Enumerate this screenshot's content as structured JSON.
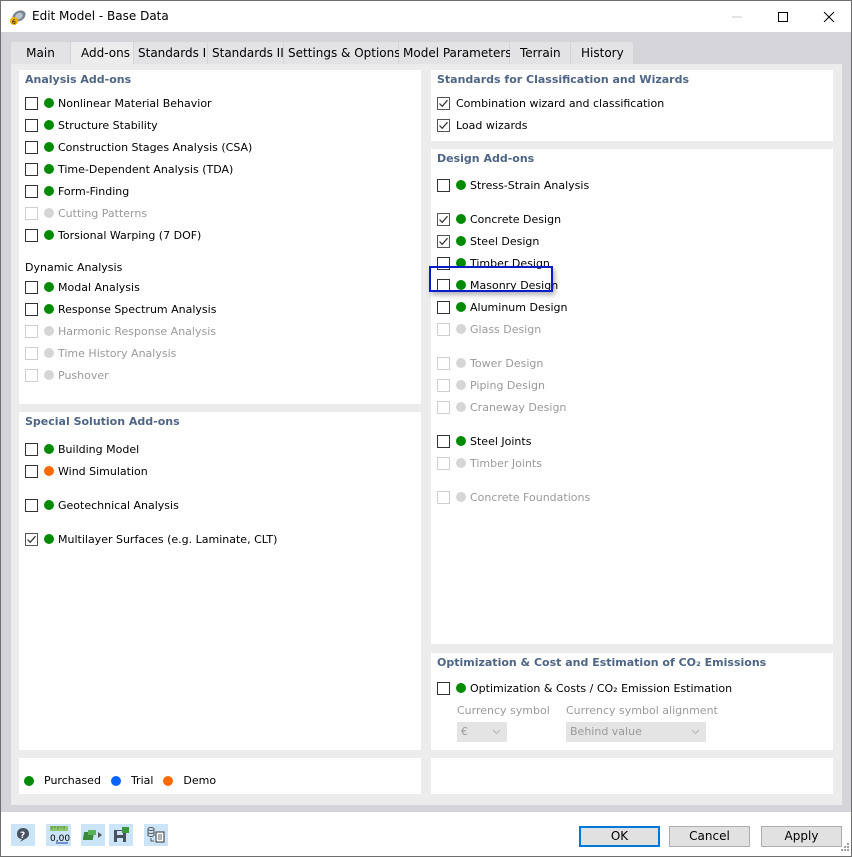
{
  "window": {
    "title": "Edit Model - Base Data",
    "icon": "model-icon",
    "controls": [
      "minimize",
      "maximize",
      "close"
    ]
  },
  "tabs": [
    {
      "label": "Main",
      "active": false
    },
    {
      "label": "Add-ons",
      "active": true
    },
    {
      "label": "Standards I",
      "active": false
    },
    {
      "label": "Standards II",
      "active": false
    },
    {
      "label": "Settings & Options",
      "active": false
    },
    {
      "label": "Model Parameters",
      "active": false
    },
    {
      "label": "Terrain",
      "active": false
    },
    {
      "label": "History",
      "active": false
    }
  ],
  "colors": {
    "purchased": "#008a00",
    "trial": "#0a64ff",
    "demo": "#ff6a00",
    "disabled": "#d6d6d6",
    "section_title": "#4e6585",
    "highlight": "#0a1ec8"
  },
  "analysis_addons": {
    "title": "Analysis Add-ons",
    "items": [
      {
        "label": "Nonlinear Material Behavior",
        "checked": false,
        "status": "purchased",
        "enabled": true
      },
      {
        "label": "Structure Stability",
        "checked": false,
        "status": "purchased",
        "enabled": true
      },
      {
        "label": "Construction Stages Analysis (CSA)",
        "checked": false,
        "status": "purchased",
        "enabled": true
      },
      {
        "label": "Time-Dependent Analysis (TDA)",
        "checked": false,
        "status": "purchased",
        "enabled": true
      },
      {
        "label": "Form-Finding",
        "checked": false,
        "status": "purchased",
        "enabled": true
      },
      {
        "label": "Cutting Patterns",
        "checked": false,
        "status": "unavailable",
        "enabled": false
      },
      {
        "label": "Torsional Warping (7 DOF)",
        "checked": false,
        "status": "purchased",
        "enabled": true
      }
    ],
    "dynamic_heading": "Dynamic Analysis",
    "dynamic_items": [
      {
        "label": "Modal Analysis",
        "checked": false,
        "status": "purchased",
        "enabled": true
      },
      {
        "label": "Response Spectrum Analysis",
        "checked": false,
        "status": "purchased",
        "enabled": true
      },
      {
        "label": "Harmonic Response Analysis",
        "checked": false,
        "status": "unavailable",
        "enabled": false
      },
      {
        "label": "Time History Analysis",
        "checked": false,
        "status": "unavailable",
        "enabled": false
      },
      {
        "label": "Pushover",
        "checked": false,
        "status": "unavailable",
        "enabled": false
      }
    ]
  },
  "special_addons": {
    "title": "Special Solution Add-ons",
    "items": [
      {
        "label": "Building Model",
        "checked": false,
        "status": "purchased",
        "enabled": true
      },
      {
        "label": "Wind Simulation",
        "checked": false,
        "status": "demo",
        "enabled": true
      },
      {
        "label": "Geotechnical Analysis",
        "checked": false,
        "status": "purchased",
        "enabled": true
      },
      {
        "label": "Multilayer Surfaces (e.g. Laminate, CLT)",
        "checked": true,
        "status": "purchased",
        "enabled": true
      }
    ]
  },
  "standards_wizards": {
    "title": "Standards for Classification and Wizards",
    "items": [
      {
        "label": "Combination wizard and classification",
        "checked": true
      },
      {
        "label": "Load wizards",
        "checked": true
      }
    ]
  },
  "design_addons": {
    "title": "Design Add-ons",
    "items": [
      {
        "label": "Stress-Strain Analysis",
        "checked": false,
        "status": "purchased",
        "enabled": true
      },
      {
        "label": "Concrete Design",
        "checked": true,
        "status": "purchased",
        "enabled": true
      },
      {
        "label": "Steel Design",
        "checked": true,
        "status": "purchased",
        "enabled": true,
        "highlighted": true
      },
      {
        "label": "Timber Design",
        "checked": false,
        "status": "purchased",
        "enabled": true
      },
      {
        "label": "Masonry Design",
        "checked": false,
        "status": "purchased",
        "enabled": true
      },
      {
        "label": "Aluminum Design",
        "checked": false,
        "status": "purchased",
        "enabled": true
      },
      {
        "label": "Glass Design",
        "checked": false,
        "status": "unavailable",
        "enabled": false
      },
      {
        "label": "Tower Design",
        "checked": false,
        "status": "unavailable",
        "enabled": false
      },
      {
        "label": "Piping Design",
        "checked": false,
        "status": "unavailable",
        "enabled": false
      },
      {
        "label": "Craneway Design",
        "checked": false,
        "status": "unavailable",
        "enabled": false
      },
      {
        "label": "Steel Joints",
        "checked": false,
        "status": "purchased",
        "enabled": true
      },
      {
        "label": "Timber Joints",
        "checked": false,
        "status": "unavailable",
        "enabled": false
      },
      {
        "label": "Concrete Foundations",
        "checked": false,
        "status": "unavailable",
        "enabled": false
      }
    ]
  },
  "optimization": {
    "title": "Optimization & Cost and Estimation of CO₂ Emissions",
    "item": {
      "label": "Optimization & Costs / CO₂ Emission Estimation",
      "checked": false,
      "status": "purchased",
      "enabled": true
    },
    "currency_symbol_label": "Currency symbol",
    "currency_symbol_value": "€",
    "alignment_label": "Currency symbol alignment",
    "alignment_value": "Behind value"
  },
  "legend": [
    {
      "label": "Purchased",
      "status": "purchased"
    },
    {
      "label": "Trial",
      "status": "trial"
    },
    {
      "label": "Demo",
      "status": "demo"
    }
  ],
  "footer": {
    "tools": [
      "help-icon",
      "units-decimal-icon",
      "model-info-icon",
      "save-defaults-icon",
      "copy-data-icon"
    ],
    "units_text": "0,00",
    "ok_label": "OK",
    "cancel_label": "Cancel",
    "apply_label": "Apply"
  }
}
